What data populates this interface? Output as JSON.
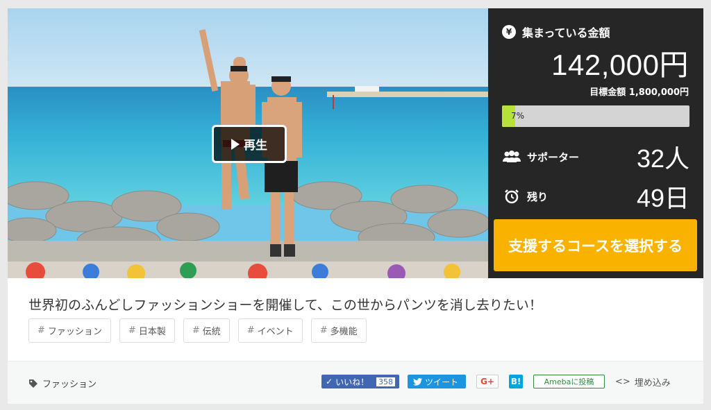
{
  "hero": {
    "play_label": "再生"
  },
  "panel": {
    "raised_label": "集まっている金額",
    "raised_icon": "yen-icon",
    "amount": "142,000円",
    "goal": "目標金額 1,800,000円",
    "progress_text": "7%",
    "progress_fraction": 0.07,
    "supporters_label": "サポーター",
    "supporters_value": "32人",
    "remaining_label": "残り",
    "remaining_value": "49日",
    "cta_label": "支援するコースを選択する",
    "colors": {
      "panel_bg": "#262626",
      "cta": "#f9b200",
      "progress": "#b7e23a"
    }
  },
  "project": {
    "title": "世界初のふんどしファッションショーを開催して、この世からパンツを消し去りたい！",
    "tags": [
      "ファッション",
      "日本製",
      "伝統",
      "イベント",
      "多機能"
    ]
  },
  "footer": {
    "category": "ファッション",
    "like_label": "いいね！",
    "like_count": "358",
    "tweet_label": "ツイート",
    "gplus_label": "G+",
    "hatena_label": "B!",
    "ameba_label": "Amebaに投稿",
    "embed_label": "埋め込み"
  }
}
